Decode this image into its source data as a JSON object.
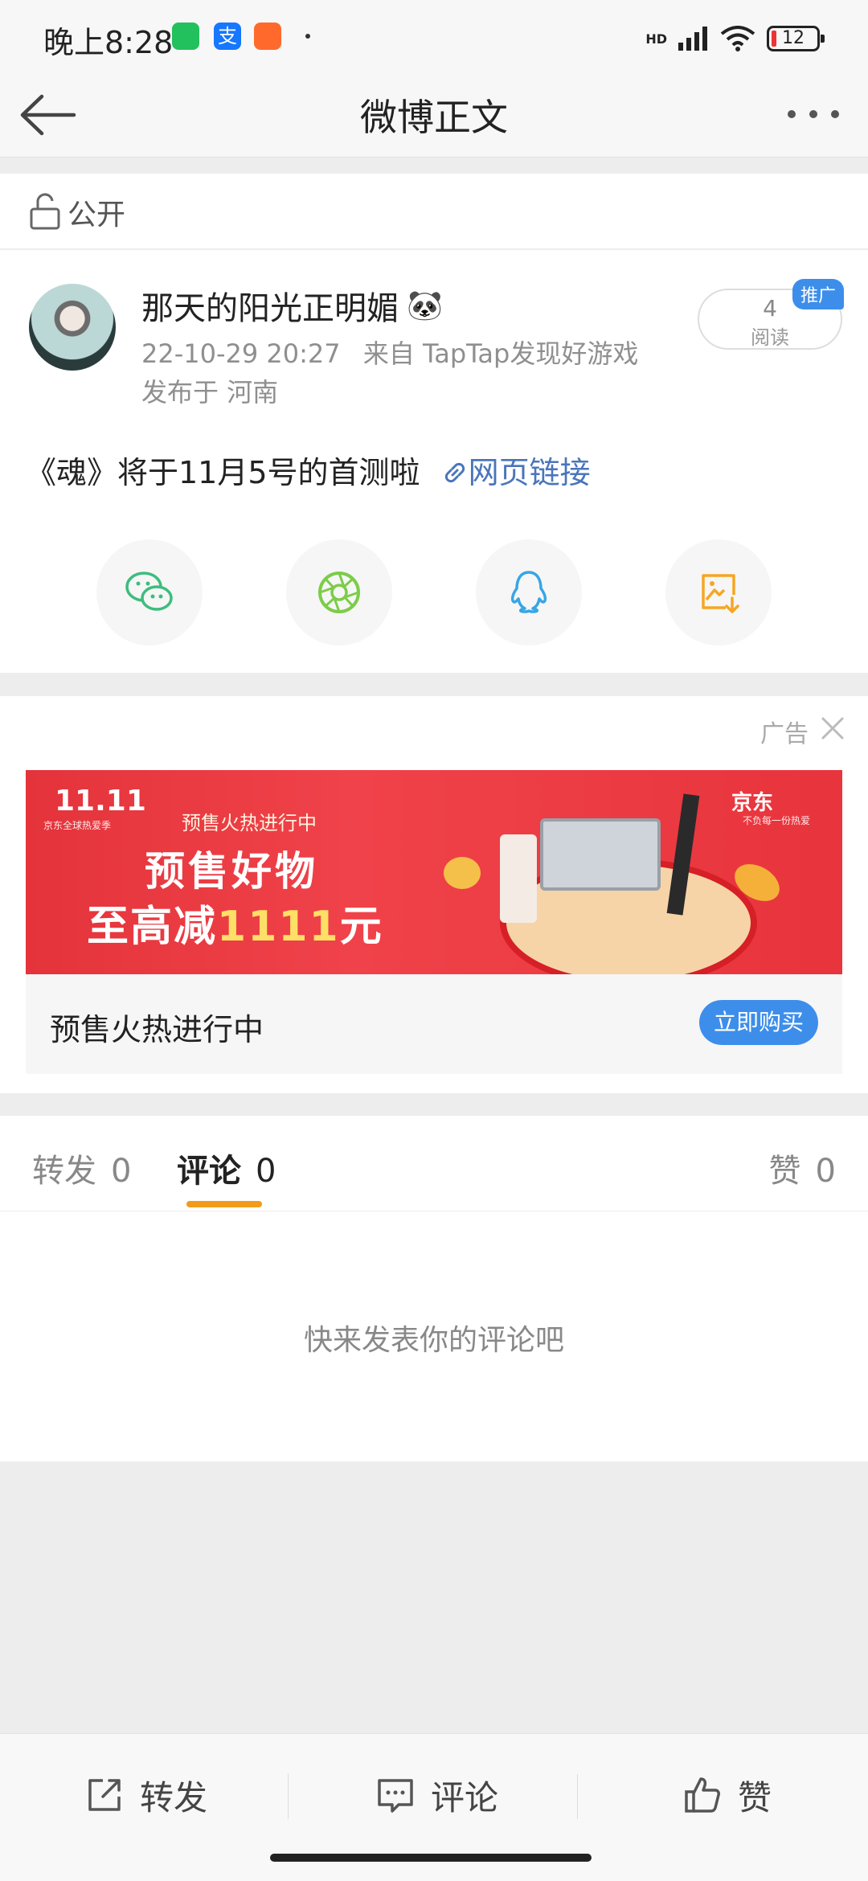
{
  "status_bar": {
    "time": "晚上8:28",
    "battery": "12",
    "network": "HD"
  },
  "nav": {
    "title": "微博正文"
  },
  "visibility": {
    "label": "公开"
  },
  "post": {
    "username": "那天的阳光正明媚",
    "emoji": "🐼",
    "timestamp": "22-10-29 20:27",
    "source": "来自 TapTap发现好游戏",
    "location": "发布于 河南",
    "reads_count": "4",
    "reads_label": "阅读",
    "promo_badge": "推广",
    "text": "《魂》将于11月5号的首测啦",
    "link_label": "网页链接"
  },
  "ad": {
    "label": "广告",
    "banner": {
      "logo": "11.11",
      "logo_sub": "京东全球热爱季",
      "top_line": "预售火热进行中",
      "main_line": "预售好物",
      "sub_prefix": "至高减",
      "sub_amount": "1111",
      "sub_unit": "元",
      "brand": "京东",
      "brand_sub": "不负每一份热爱"
    },
    "title": "预售火热进行中",
    "cta": "立即购买"
  },
  "tabs": {
    "repost_label": "转发",
    "repost_count": "0",
    "comment_label": "评论",
    "comment_count": "0",
    "like_label": "赞",
    "like_count": "0"
  },
  "empty_state": "快来发表你的评论吧",
  "bottom_bar": {
    "repost": "转发",
    "comment": "评论",
    "like": "赞"
  },
  "colors": {
    "accent_blue": "#3d8eea",
    "link_blue": "#4a75ba",
    "tab_underline": "#f29a1b"
  }
}
